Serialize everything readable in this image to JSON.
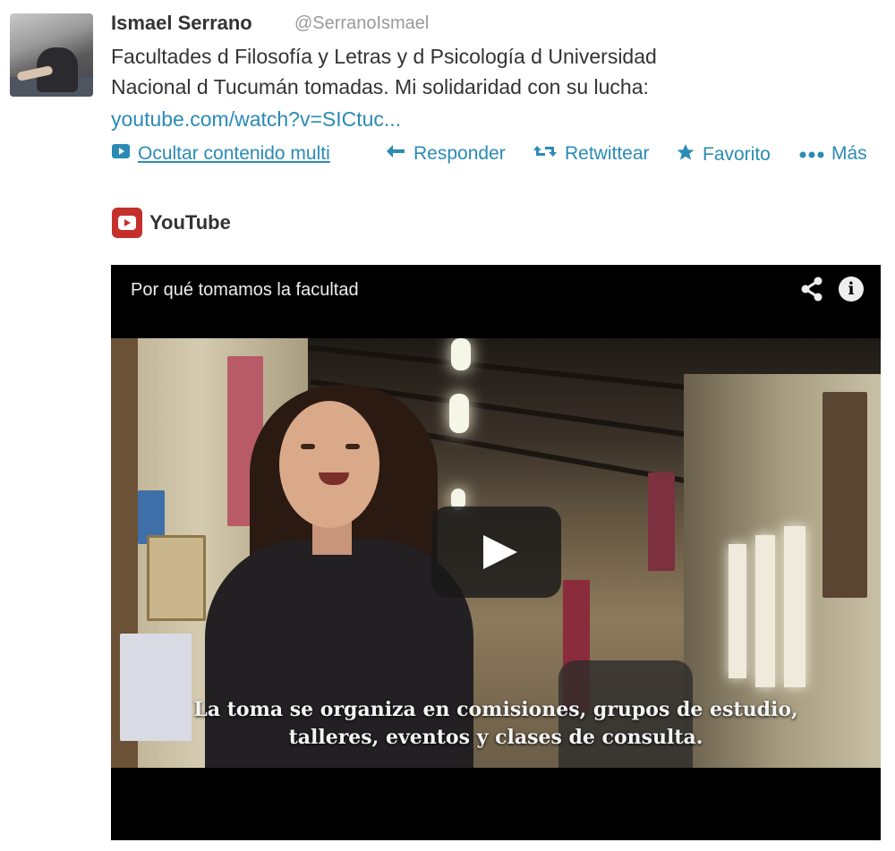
{
  "tweet": {
    "author_name": "Ismael Serrano",
    "author_handle": "@SerranoIsmael",
    "text_line1": "Facultades d Filosofía y Letras y d Psicología d Universidad",
    "text_line2": "Nacional d Tucumán tomadas. Mi solidaridad con su lucha:",
    "link": "youtube.com/watch?v=SICtuc..."
  },
  "actions": {
    "hide_media": "Ocultar contenido multi",
    "reply": "Responder",
    "retweet": "Retwittear",
    "favorite": "Favorito",
    "more": "Más"
  },
  "media": {
    "provider": "YouTube",
    "video_title": "Por qué tomamos la facultad",
    "subtitle_line1": "La toma se organiza en comisiones, grupos de estudio,",
    "subtitle_line2": "talleres, eventos y clases de consulta."
  },
  "icons": [
    "media-icon",
    "reply-icon",
    "retweet-icon",
    "star-icon",
    "more-dots-icon",
    "youtube-logo-icon",
    "share-icon",
    "info-icon",
    "play-icon"
  ],
  "colors": {
    "link": "#2a8bb5",
    "youtube_red": "#c4302b",
    "text": "#333333",
    "handle": "#999999"
  }
}
